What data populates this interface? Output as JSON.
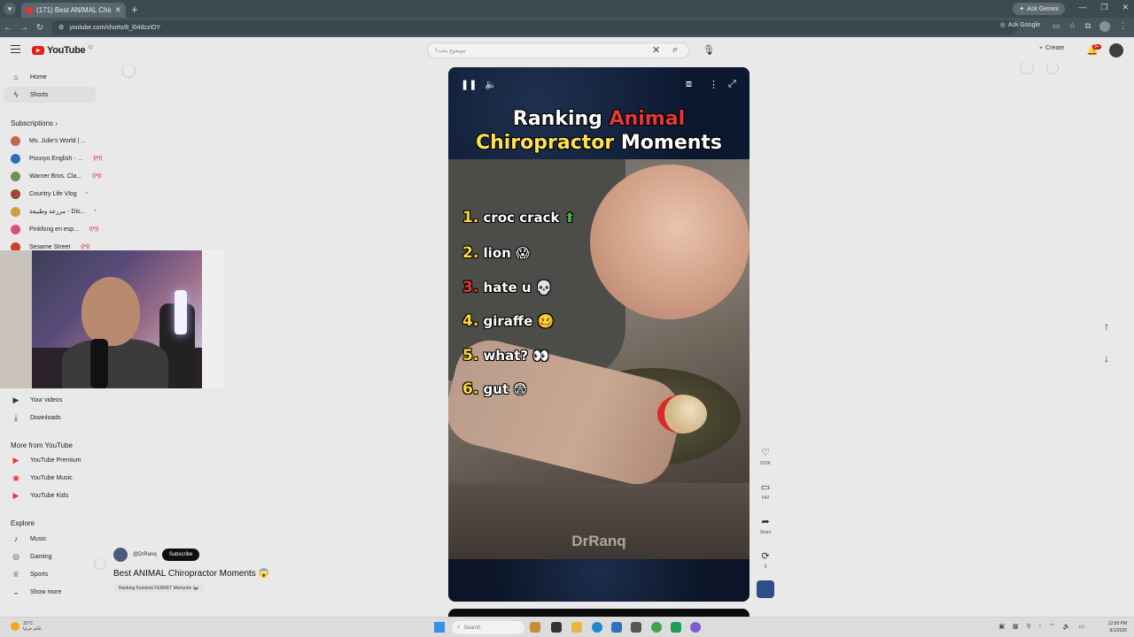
{
  "browser": {
    "tab_title": "(171) Best ANIMAL Chiropr",
    "url": "youtube.com/shorts/8_l04dzziOY",
    "ask_gemini": "Ask Gemini",
    "ask_google": "Ask Google"
  },
  "header": {
    "logo": "YouTube",
    "logo_sup": "IQ",
    "search_placeholder": "موضوع بحث؟",
    "create": "Create",
    "notif_count": "9+"
  },
  "sidebar": {
    "home": "Home",
    "shorts": "Shorts",
    "subscriptions_heading": "Subscriptions",
    "subscriptions": [
      {
        "name": "Ms. Julie's World | ...",
        "color": "#c4664a"
      },
      {
        "name": "Pocoyo English - ...",
        "color": "#2f6fbe"
      },
      {
        "name": "Warner Bros. Cla...",
        "color": "#7a8a5a"
      },
      {
        "name": "Country Life Vlog",
        "color": "#a0463a"
      },
      {
        "name": "مزرعة وطبيعة - Dis...",
        "color": "#c9a13a"
      },
      {
        "name": "Pinkfong en esp...",
        "color": "#e14b7a"
      },
      {
        "name": "Sesame Street",
        "color": "#d43a2a"
      }
    ],
    "your_videos": "Your videos",
    "downloads": "Downloads",
    "more_heading": "More from YouTube",
    "premium": "YouTube Premium",
    "music": "YouTube Music",
    "kids": "YouTube Kids",
    "explore_heading": "Explore",
    "explore_music": "Music",
    "gaming": "Gaming",
    "sports": "Sports",
    "show_more": "Show more"
  },
  "short": {
    "title_part1": "Ranking ",
    "title_part2": "Animal",
    "title_part3": "Chiropractor",
    "title_part4": " Moments",
    "ranks": [
      {
        "num": "1.",
        "text": "croc crack"
      },
      {
        "num": "2.",
        "text": "lion"
      },
      {
        "num": "3.",
        "text": "hate u"
      },
      {
        "num": "4.",
        "text": "giraffe"
      },
      {
        "num": "5.",
        "text": "what?"
      },
      {
        "num": "6.",
        "text": "gut"
      }
    ],
    "watermark": "DrRanq"
  },
  "actions": {
    "likes": "553K",
    "comments": "643",
    "share": "Share",
    "remix": "5"
  },
  "video_info": {
    "channel": "@DrRanq",
    "subscribe": "Subscribe",
    "title": "Best ANIMAL Chiropractor Moments 😱",
    "suggestion": "Ranking Funniest FERRET Moments 🦦"
  },
  "taskbar": {
    "temp": "31°C",
    "weather": "غائم جزئيا",
    "search": "Search",
    "time": "12:58 PM",
    "date": "8/1/2026"
  }
}
